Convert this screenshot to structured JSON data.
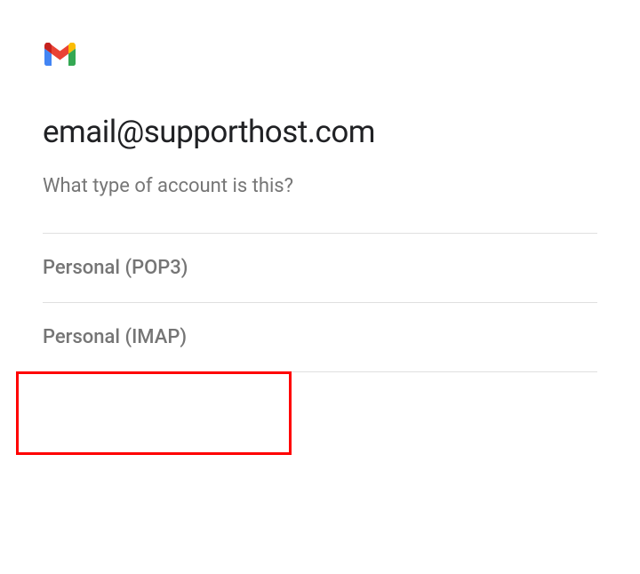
{
  "email": "email@supporthost.com",
  "subtitle": "What type of account is this?",
  "options": [
    {
      "label": "Personal (POP3)"
    },
    {
      "label": "Personal (IMAP)"
    }
  ],
  "icon_name": "gmail-logo"
}
